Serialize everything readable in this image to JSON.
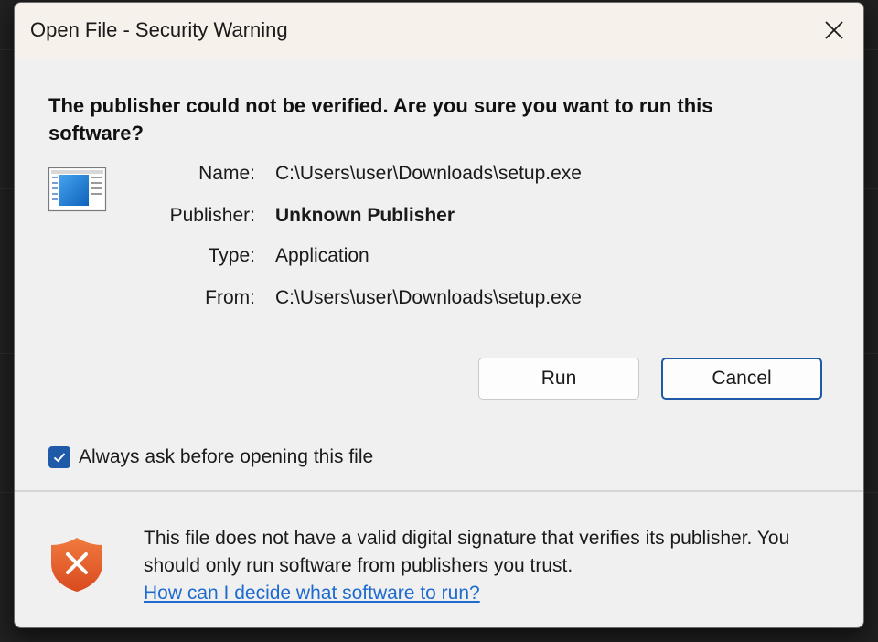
{
  "dialog": {
    "title": "Open File - Security Warning",
    "heading": "The publisher could not be verified.  Are you sure you want to run this software?",
    "fields": {
      "name_label": "Name:",
      "name_value": "C:\\Users\\user\\Downloads\\setup.exe",
      "publisher_label": "Publisher:",
      "publisher_value": "Unknown Publisher",
      "type_label": "Type:",
      "type_value": "Application",
      "from_label": "From:",
      "from_value": "C:\\Users\\user\\Downloads\\setup.exe"
    },
    "buttons": {
      "run_label": "Run",
      "cancel_label": "Cancel"
    },
    "checkbox": {
      "label": "Always ask before opening this file",
      "checked": true
    },
    "warning": {
      "text": "This file does not have a valid digital signature that verifies its publisher.  You should only run software from publishers you trust.",
      "link": "How can I decide what software to run?"
    },
    "icons": {
      "close": "close-icon",
      "app": "application-window-icon",
      "shield": "shield-warning-icon",
      "check": "checkmark-icon"
    },
    "colors": {
      "accent": "#1e5aa8",
      "link": "#1e6bd0",
      "shield": "#e25d2a"
    }
  }
}
